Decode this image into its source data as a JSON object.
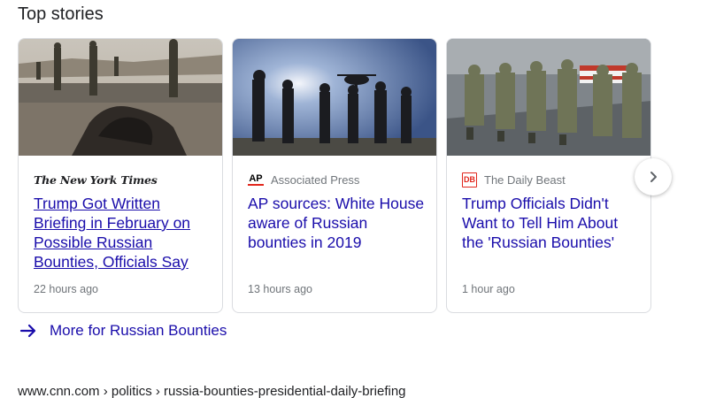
{
  "section": {
    "title": "Top stories"
  },
  "stories": [
    {
      "source": "The New York Times",
      "headline": "Trump Got Written Briefing in February on Possible Russian Bounties, Officials Say",
      "time": "22 hours ago"
    },
    {
      "source_icon": "AP",
      "source": "Associated Press",
      "headline": "AP sources: White House aware of Russian bounties in 2019",
      "time": "13 hours ago"
    },
    {
      "source_icon": "DB",
      "source": "The Daily Beast",
      "headline": "Trump Officials Didn't Want to Tell Him About the 'Russian Bounties'",
      "time": "1 hour ago"
    }
  ],
  "carousel": {
    "next_icon": "chevron-right-icon"
  },
  "more": {
    "icon": "arrow-right-icon",
    "label": "More for Russian Bounties"
  },
  "result": {
    "breadcrumb": "www.cnn.com › politics › russia-bounties-presidential-daily-briefing"
  },
  "colors": {
    "link": "#1a0dab",
    "meta": "#70757a",
    "accent_red": "#e1261c",
    "border": "#dadce0"
  }
}
